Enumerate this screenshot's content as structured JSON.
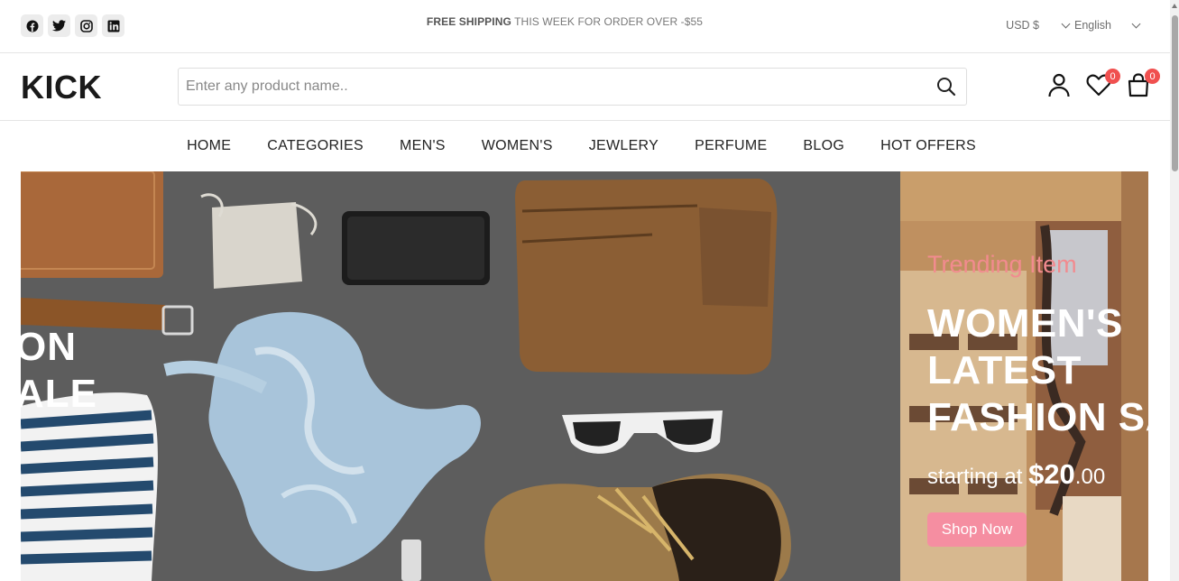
{
  "topbar": {
    "social": [
      {
        "name": "facebook-icon"
      },
      {
        "name": "twitter-icon"
      },
      {
        "name": "instagram-icon"
      },
      {
        "name": "linkedin-icon"
      }
    ],
    "announce_bold": "FREE SHIPPING",
    "announce_rest": " THIS WEEK FOR ORDER OVER -$55",
    "currency": "USD $",
    "language": "English"
  },
  "header": {
    "logo": "KICK",
    "search_placeholder": "Enter any product name..",
    "wishlist_count": "0",
    "cart_count": "0"
  },
  "nav": {
    "items": [
      "HOME",
      "CATEGORIES",
      "MEN'S",
      "WOMEN'S",
      "JEWLERY",
      "PERFUME",
      "BLOG",
      "HOT OFFERS"
    ]
  },
  "hero": {
    "slide1_line1": "ON",
    "slide1_line2": "ALE",
    "slide2_subtitle": "Trending Item",
    "slide2_title_line1": "WOMEN'S",
    "slide2_title_line2": "LATEST",
    "slide2_title_line3": "FASHION SA",
    "slide2_price_prefix": "starting at ",
    "slide2_price_amount": "$20",
    "slide2_price_cents": ".00",
    "slide2_button": "Shop Now"
  },
  "colors": {
    "accent_pink": "#f58ea1",
    "subtitle_pink": "#f28b8f",
    "badge_red": "#f0504f"
  }
}
